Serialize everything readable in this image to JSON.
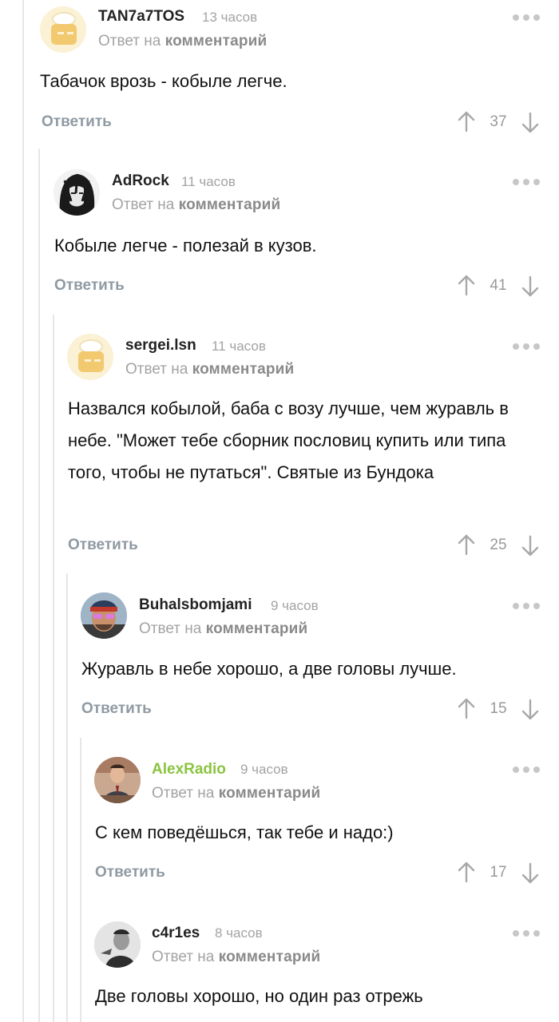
{
  "reply_label": "Ответить",
  "reply_prefix": "Ответ на",
  "reply_link": "комментарий",
  "colors": {
    "accent_green": "#8ac43f",
    "muted": "#a3a3a3",
    "thread_line": "#e6e6e6"
  },
  "comments": [
    {
      "user": "TAN7a7TOS",
      "time": "13 часов",
      "text": "Табачок врозь - кобыле легче.",
      "score": "37",
      "avatar": "default-cooking-pot-avatar"
    },
    {
      "user": "AdRock",
      "time": "11 часов",
      "text": "Кобыле легче - полезай в кузов.",
      "score": "41",
      "avatar": "anime-portrait-avatar"
    },
    {
      "user": "sergei.lsn",
      "time": "11 часов",
      "text": "Назвался кобылой, баба с возу лучше, чем журавль в небе. \"Может тебе сборник пословиц купить или типа того, чтобы не путаться\". Святые из Бундока",
      "score": "25",
      "avatar": "default-cooking-pot-avatar"
    },
    {
      "user": "Buhalsbomjami",
      "time": "9 часов",
      "text": "Журавль в небе хорошо, а две головы лучше.",
      "score": "15",
      "avatar": "man-in-beanie-avatar"
    },
    {
      "user": "AlexRadio",
      "time": "9 часов",
      "text": "С кем поведёшься, так тебе и надо:)",
      "score": "17",
      "avatar": "man-in-suit-avatar"
    },
    {
      "user": "c4r1es",
      "time": "8 часов",
      "text": "Две головы хорошо, но один раз отрежь",
      "score": "",
      "avatar": "bw-portrait-avatar"
    }
  ]
}
